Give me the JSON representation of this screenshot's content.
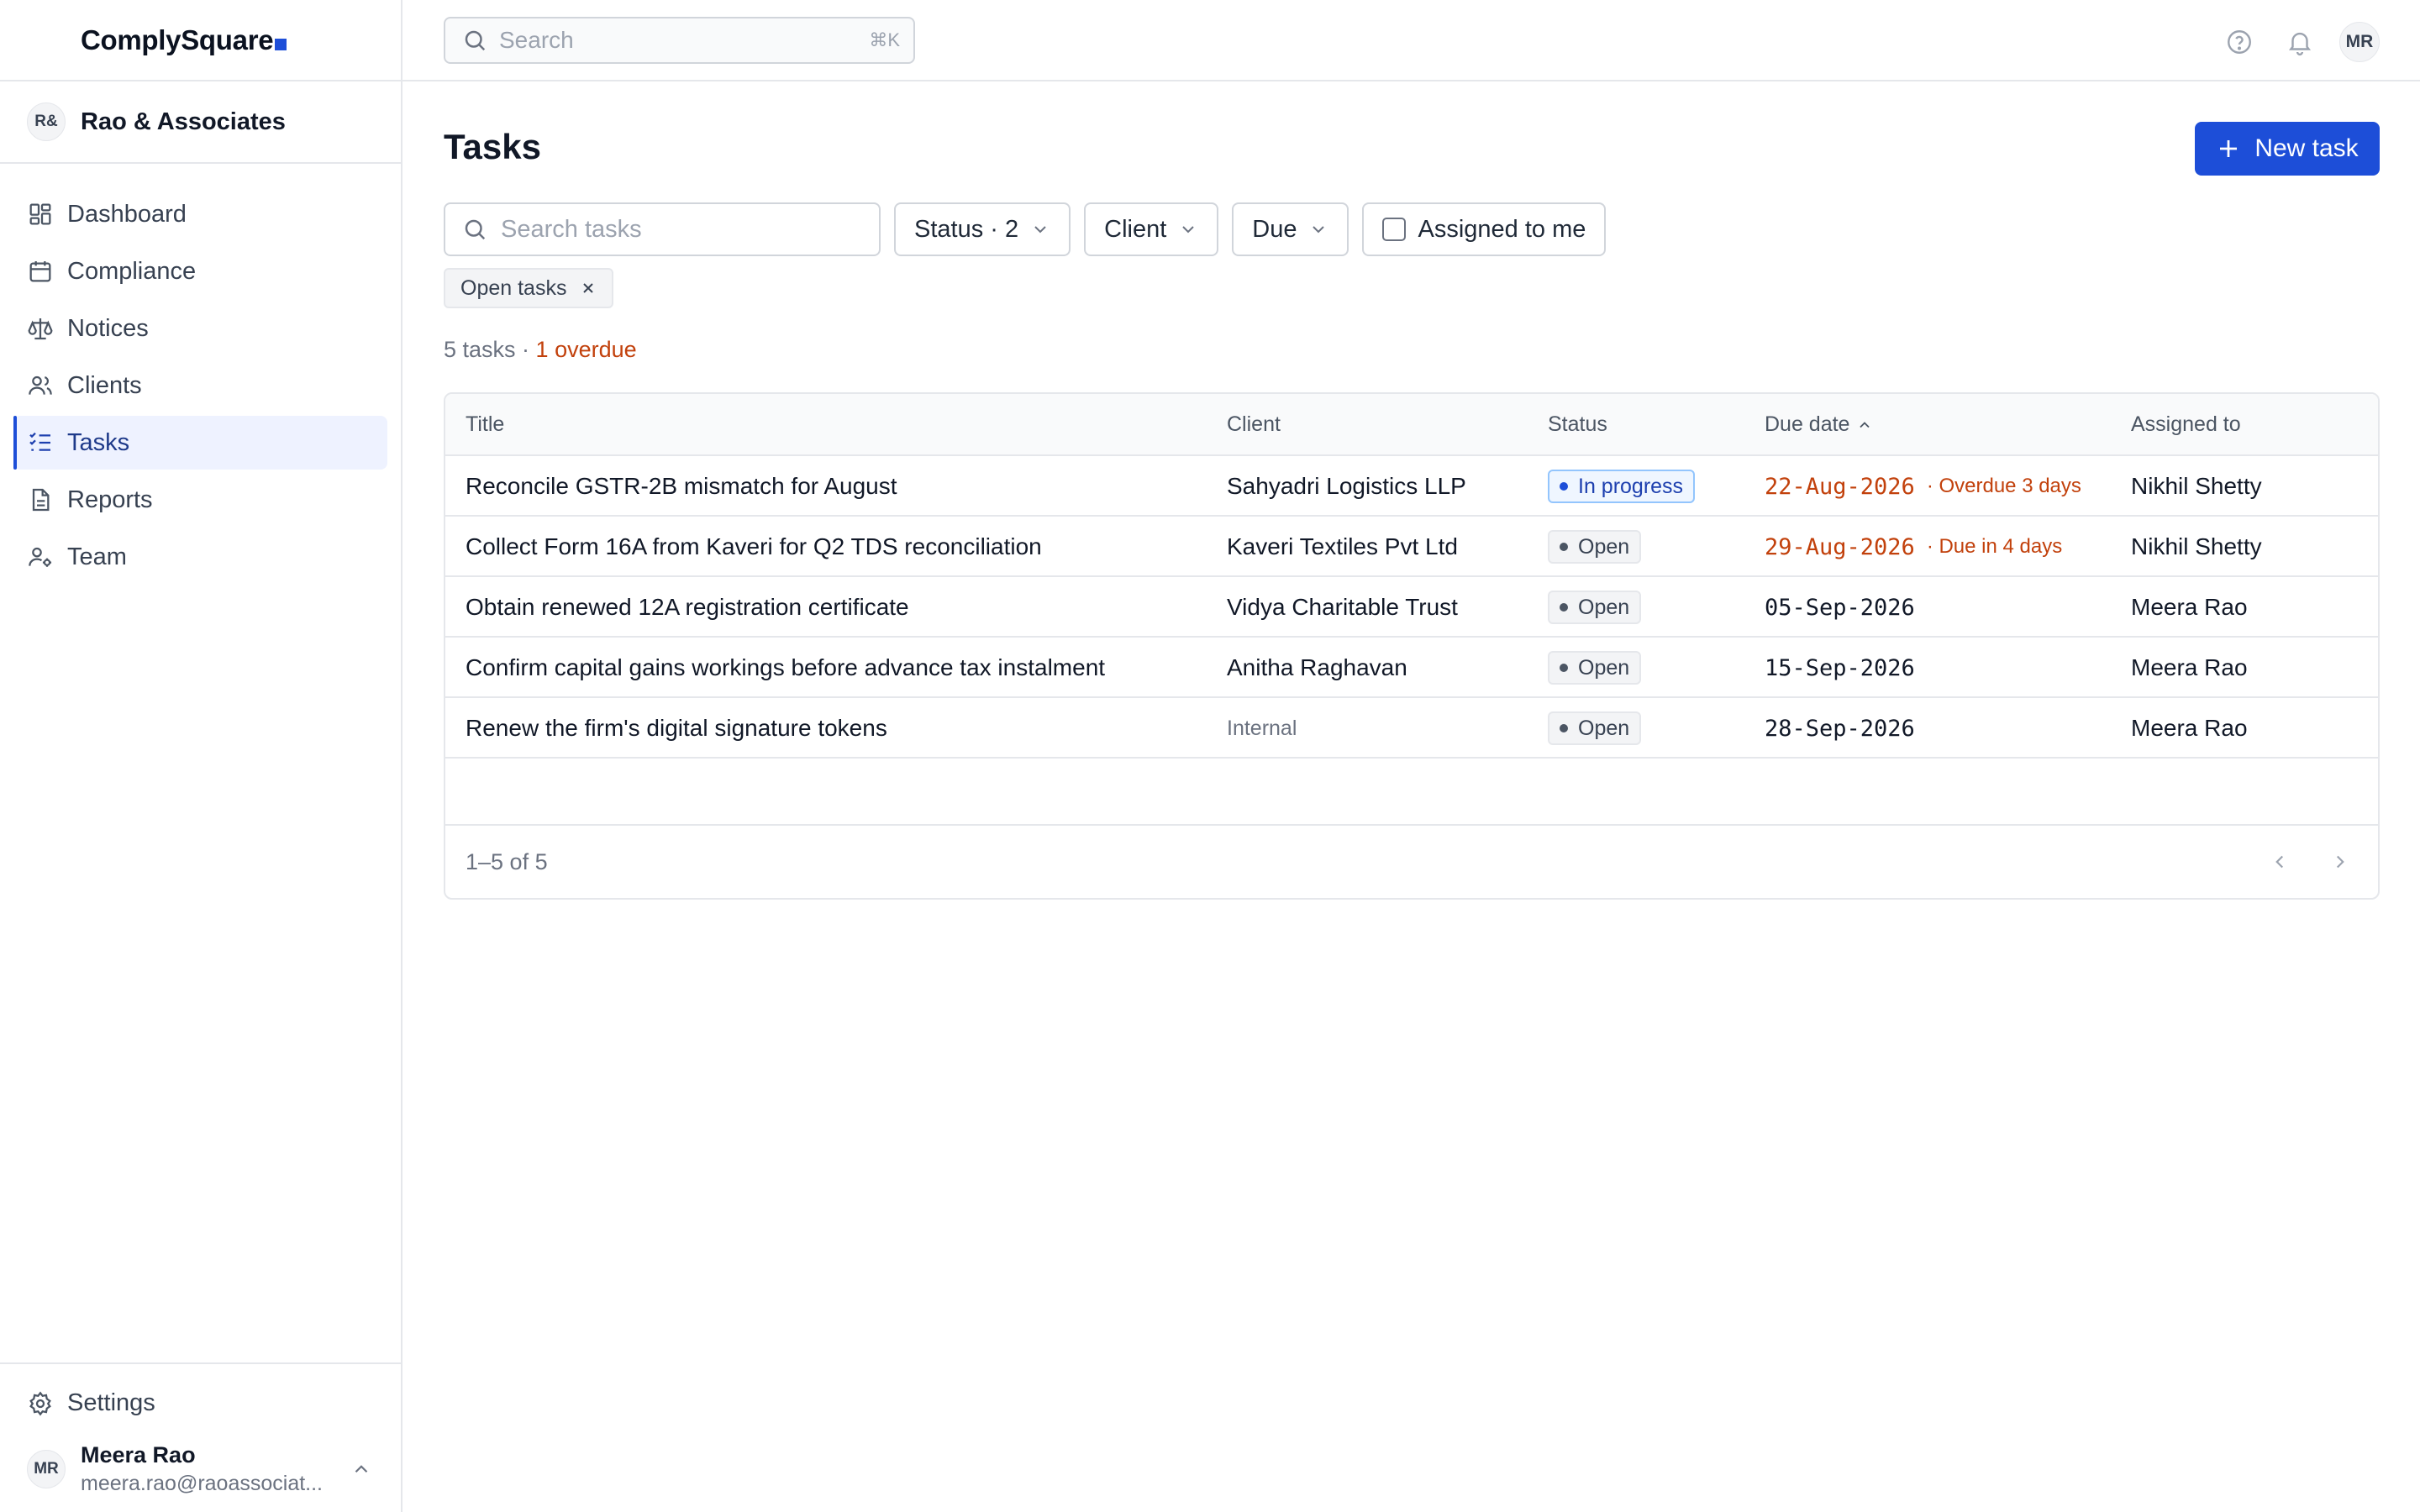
{
  "app": {
    "name": "ComplySquare"
  },
  "org": {
    "initials": "R&",
    "name": "Rao & Associates"
  },
  "sidebar": {
    "items": [
      {
        "label": "Dashboard",
        "icon": "dashboard-icon"
      },
      {
        "label": "Compliance",
        "icon": "calendar-icon"
      },
      {
        "label": "Notices",
        "icon": "scale-icon"
      },
      {
        "label": "Clients",
        "icon": "users-icon"
      },
      {
        "label": "Tasks",
        "icon": "task-list-icon",
        "active": true
      },
      {
        "label": "Reports",
        "icon": "document-icon"
      },
      {
        "label": "Team",
        "icon": "user-gear-icon"
      }
    ],
    "settings_label": "Settings",
    "user": {
      "initials": "MR",
      "name": "Meera Rao",
      "email": "meera.rao@raoassociat..."
    }
  },
  "topbar": {
    "search_placeholder": "Search",
    "search_shortcut": "⌘K",
    "avatar_initials": "MR"
  },
  "page": {
    "title": "Tasks",
    "new_task_label": "New task"
  },
  "filters": {
    "search_placeholder": "Search tasks",
    "status_label": "Status · 2",
    "client_label": "Client",
    "due_label": "Due",
    "assigned_label": "Assigned to me",
    "assigned_checked": false
  },
  "active_chip": {
    "label": "Open tasks"
  },
  "summary": {
    "count_text": "5 tasks ·",
    "overdue_text": "1 overdue"
  },
  "table": {
    "headers": {
      "title": "Title",
      "client": "Client",
      "status": "Status",
      "due_date": "Due date",
      "assigned_to": "Assigned to"
    },
    "rows": [
      {
        "title": "Reconcile GSTR-2B mismatch for August",
        "client": "Sahyadri Logistics LLP",
        "status": "In progress",
        "due": "22-Aug-2026",
        "due_note": "· Overdue 3 days",
        "assigned": "Nikhil Shetty"
      },
      {
        "title": "Collect Form 16A from Kaveri for Q2 TDS reconciliation",
        "client": "Kaveri Textiles Pvt Ltd",
        "status": "Open",
        "due": "29-Aug-2026",
        "due_note": "· Due in 4 days",
        "assigned": "Nikhil Shetty"
      },
      {
        "title": "Obtain renewed 12A registration certificate",
        "client": "Vidya Charitable Trust",
        "status": "Open",
        "due": "05-Sep-2026",
        "due_note": "",
        "assigned": "Meera Rao"
      },
      {
        "title": "Confirm capital gains workings before advance tax instalment",
        "client": "Anitha Raghavan",
        "status": "Open",
        "due": "15-Sep-2026",
        "due_note": "",
        "assigned": "Meera Rao"
      },
      {
        "title": "Renew the firm's digital signature tokens",
        "client": "Internal",
        "status": "Open",
        "due": "28-Sep-2026",
        "due_note": "",
        "assigned": "Meera Rao"
      }
    ],
    "pagination_text": "1–5 of 5"
  },
  "colors": {
    "accent": "#1d4ed8",
    "warning": "#c2410c",
    "active_nav_bg": "#eef2ff"
  }
}
